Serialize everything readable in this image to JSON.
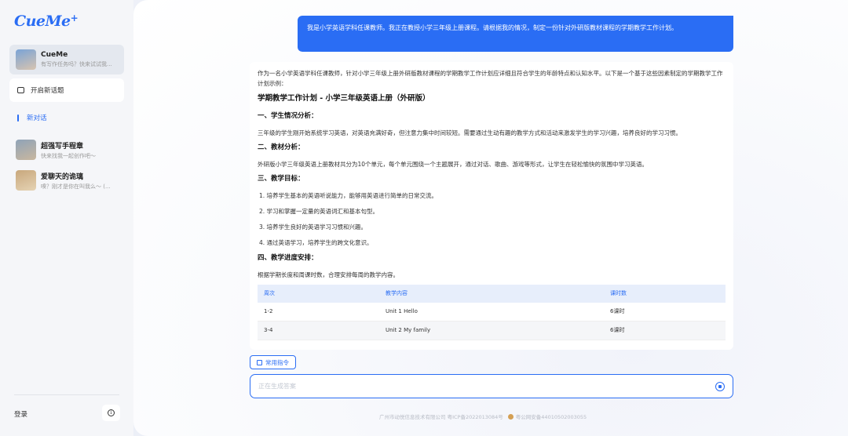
{
  "sidebar": {
    "logo": "CueMe",
    "logo_plus": "+",
    "active_bot": {
      "name": "CueMe",
      "sub": "有写作任务吗？快来试试我..."
    },
    "new_topic_label": "开启新话题",
    "new_chat_label": "新对话",
    "bots": [
      {
        "name": "超强写手程章",
        "sub": "快来找我一起创作吧～"
      },
      {
        "name": "爱聊天的诡璃",
        "sub": "嗅？刚才是你在叫我么～ (..."
      }
    ],
    "login_label": "登录",
    "info_icon": "info-icon"
  },
  "chat": {
    "user_message": "我是小学英语学科任课教师。我正在教授小学三年级上册课程。请根据我的情况，制定一份针对外研版教材课程的学期教学工作计划。",
    "intro": "作为一名小学英语学科任课教师，针对小学三年级上册外研版教材课程的学期教学工作计划应详细且符合学生的年龄特点和认知水平。以下是一个基于这些因素制定的学期教学工作计划示例：",
    "plan_title": "学期教学工作计划 - 小学三年级英语上册（外研版）",
    "section1_title": "一、学生情况分析：",
    "section1_text": "三年级的学生刚开始系统学习英语，对英语充满好奇，但注意力集中时间较短。需要通过生动有趣的教学方式和活动来激发学生的学习兴趣，培养良好的学习习惯。",
    "section2_title": "二、教材分析：",
    "section2_text": "外研版小学三年级英语上册教材共分为10个单元，每个单元围绕一个主题展开，通过对话、歌曲、游戏等形式，让学生在轻松愉快的氛围中学习英语。",
    "section3_title": "三、教学目标：",
    "goals": [
      "1. 培养学生基本的英语听说能力，能够用英语进行简单的日常交流。",
      "2. 学习和掌握一定量的英语词汇和基本句型。",
      "3. 培养学生良好的英语学习习惯和兴趣。",
      "4. 通过英语学习，培养学生的跨文化意识。"
    ],
    "section4_title": "四、教学进度安排：",
    "section4_text": "根据学期长度和周课时数，合理安排每周的教学内容。",
    "table": {
      "headers": [
        "周次",
        "教学内容",
        "课时数"
      ],
      "rows": [
        [
          "1-2",
          "Unit 1 Hello",
          "6课时"
        ],
        [
          "3-4",
          "Unit 2 My family",
          "6课时"
        ]
      ]
    }
  },
  "composer": {
    "common_commands_label": "常用指令",
    "placeholder": "正在生成答案",
    "stop_icon": "stop-icon"
  },
  "footer": {
    "company": "广州市动悦信息技术有限公司 粤ICP备2022013084号",
    "police": "粤公网安备44010502003055"
  },
  "colors": {
    "accent": "#2a6df4"
  }
}
